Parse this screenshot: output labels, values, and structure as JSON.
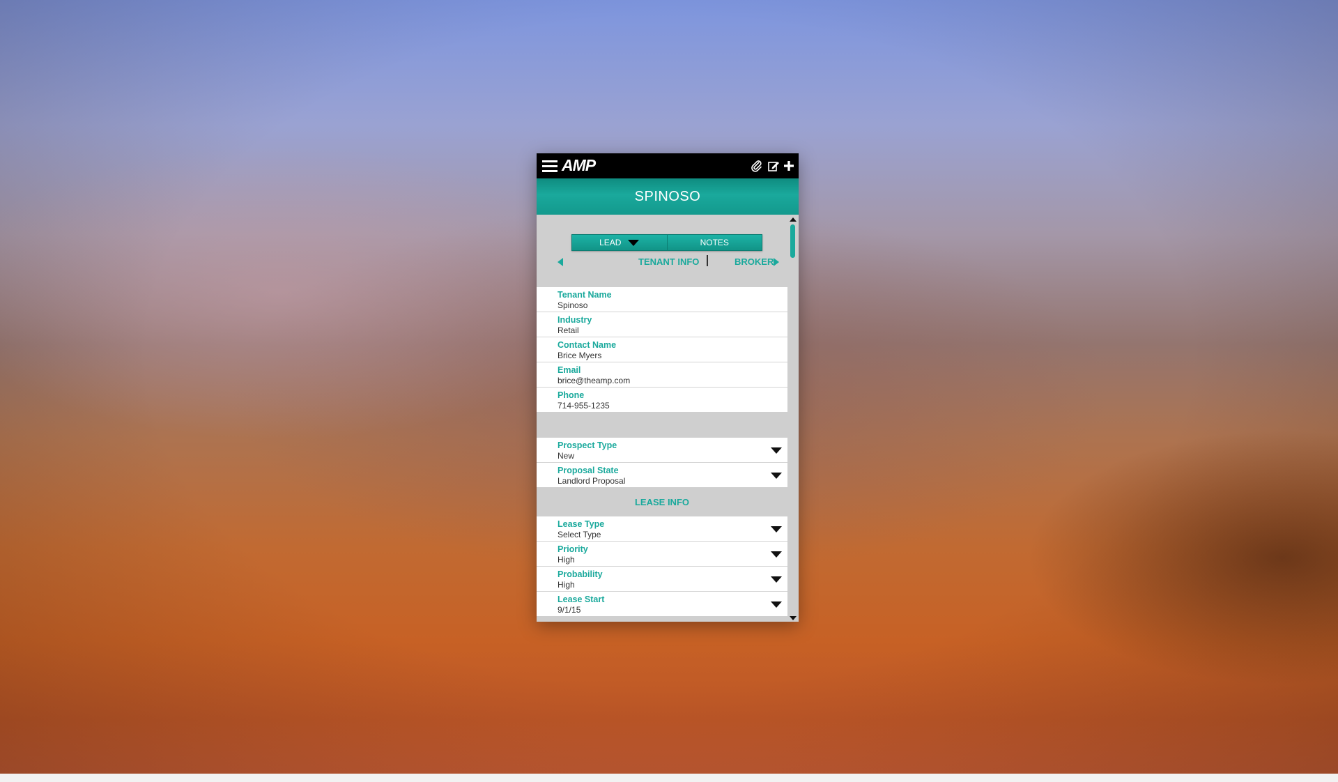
{
  "app": {
    "logo_text": "AMP",
    "record_title": "SPINOSO"
  },
  "toolbar": {
    "icons": [
      "menu-icon",
      "paperclip-icon",
      "edit-icon",
      "plus-icon"
    ]
  },
  "segmented": {
    "lead_label": "LEAD",
    "notes_label": "NOTES"
  },
  "subnav": {
    "current_tab": "TENANT INFO",
    "next_tab": "BROKER"
  },
  "tenant_fields": [
    {
      "label": "Tenant Name",
      "value": "Spinoso"
    },
    {
      "label": "Industry",
      "value": "Retail"
    },
    {
      "label": "Contact Name",
      "value": "Brice Myers"
    },
    {
      "label": "Email",
      "value": "brice@theamp.com"
    },
    {
      "label": "Phone",
      "value": "714-955-1235"
    }
  ],
  "status_fields": [
    {
      "label": "Prospect Type",
      "value": "New"
    },
    {
      "label": "Proposal State",
      "value": "Landlord Proposal"
    }
  ],
  "lease_section_title": "LEASE INFO",
  "lease_fields": [
    {
      "label": "Lease Type",
      "value": "Select Type"
    },
    {
      "label": "Priority",
      "value": "High"
    },
    {
      "label": "Probability",
      "value": "High"
    },
    {
      "label": "Lease Start",
      "value": "9/1/15"
    }
  ],
  "colors": {
    "accent": "#1aa99c",
    "topbar": "#000000",
    "panel": "#cfcfcf"
  }
}
